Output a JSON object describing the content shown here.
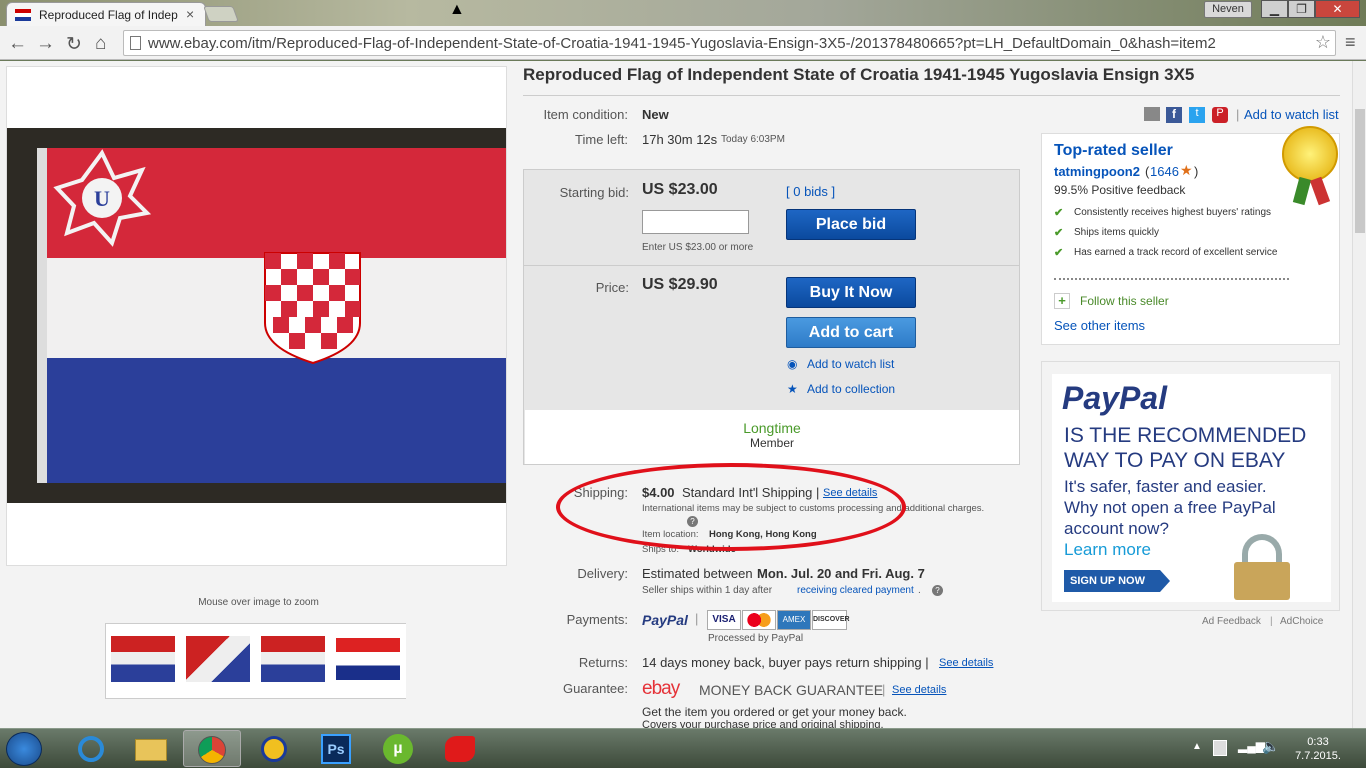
{
  "browser": {
    "tab_title": "Reproduced Flag of Indep",
    "user": "Neven",
    "url": "www.ebay.com/itm/Reproduced-Flag-of-Independent-State-of-Croatia-1941-1945-Yugoslavia-Ensign-3X5-/201378480665?pt=LH_DefaultDomain_0&hash=item2"
  },
  "item": {
    "title": "Reproduced Flag of Independent State of Croatia 1941-1945 Yugoslavia Ensign 3X5",
    "condition_label": "Item condition:",
    "condition": "New",
    "time_label": "Time left:",
    "time_left": "17h 30m 12s",
    "time_end": "Today 6:03PM",
    "zoom_hint": "Mouse over image to zoom"
  },
  "share": {
    "watch": "Add to watch list"
  },
  "bid": {
    "label": "Starting bid:",
    "price": "US $23.00",
    "bids": "[ 0 bids ]",
    "button": "Place bid",
    "hint": "Enter US $23.00 or more",
    "input_value": ""
  },
  "buy": {
    "label": "Price:",
    "price": "US $29.90",
    "buy_now": "Buy It Now",
    "add_cart": "Add to cart",
    "watch": "Add to watch list",
    "collection": "Add to collection"
  },
  "badge": {
    "title": "Longtime",
    "sub": "Member"
  },
  "shipping": {
    "label": "Shipping:",
    "cost": "$4.00",
    "method": "Standard Int'l Shipping |",
    "details": "See details",
    "note": "International items may be subject to customs processing and additional charges.",
    "loc_label": "Item location:",
    "loc": "Hong Kong, Hong Kong",
    "to_label": "Ships to:",
    "to": "Worldwide"
  },
  "delivery": {
    "label": "Delivery:",
    "text": "Estimated between",
    "dates": "Mon. Jul. 20 and Fri. Aug. 7",
    "note": "Seller ships within 1 day after",
    "note_link": "receiving cleared payment",
    "note_end": "."
  },
  "payments": {
    "label": "Payments:",
    "paypal": "PayPal",
    "processed": "Processed by PayPal",
    "cards": [
      "VISA",
      "MC",
      "AMEX",
      "DISCOVER"
    ]
  },
  "returns": {
    "label": "Returns:",
    "text": "14 days money back, buyer pays return shipping |",
    "details": "See details"
  },
  "guarantee": {
    "label": "Guarantee:",
    "ebay": "ebay",
    "mbg": "MONEY BACK GUARANTEE",
    "sep": "|",
    "details": "See details",
    "l1": "Get the item you ordered or get your money back.",
    "l2": "Covers your purchase price and original shipping."
  },
  "seller": {
    "badge": "Top-rated seller",
    "name": "tatmingpoon2",
    "score": "1646",
    "feedback": "99.5% Positive feedback",
    "points": [
      "Consistently receives highest buyers' ratings",
      "Ships items quickly",
      "Has earned a track record of excellent service"
    ],
    "follow": "Follow this seller",
    "other": "See other items"
  },
  "ad": {
    "logo": "PayPal",
    "h1": "IS THE RECOMMENDED",
    "h2": "WAY TO PAY ON EBAY",
    "b1": "It's safer, faster and easier.",
    "b2": "Why not open a free PayPal",
    "b3": "account now?",
    "learn": "Learn more",
    "signup": "SIGN UP NOW",
    "feedback": "Ad Feedback",
    "choice": "AdChoice"
  },
  "clock": {
    "time": "0:33",
    "date": "7.7.2015."
  },
  "colors": {
    "ebay_blue": "#0654ba",
    "button_blue": "#0b4a9e",
    "paypal_navy": "#253b80",
    "paypal_blue": "#179bd7",
    "red_circle": "#e0101a",
    "green": "#4a9a2a"
  }
}
